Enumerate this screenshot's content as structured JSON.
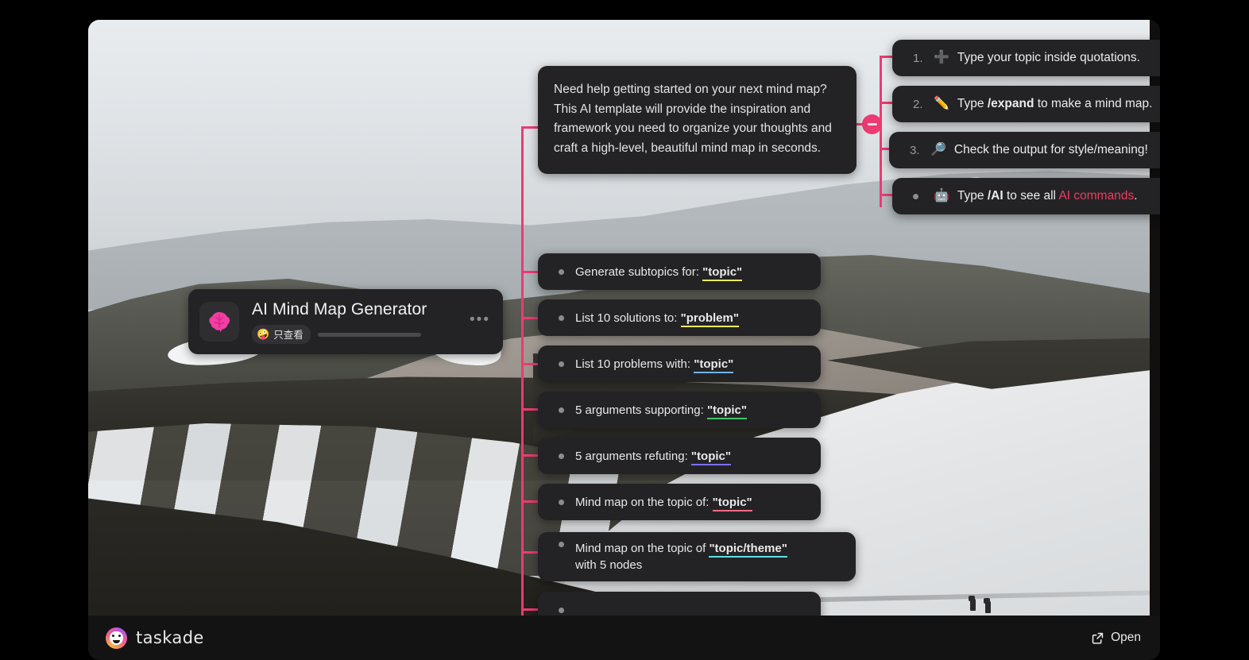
{
  "document": {
    "title": "AI Mind Map Generator",
    "permission_badge": "只查看",
    "permission_emoji": "🤪",
    "menu_label": "•••",
    "avatar_icon": "brain-icon"
  },
  "description": {
    "text": "Need help getting started on your next mind map? This AI template will provide the inspiration and framework you need to organize your thoughts and craft a high-level, beautiful mind map in seconds."
  },
  "steps": [
    {
      "marker": "1.",
      "marker_type": "number",
      "emoji": "➕",
      "icon": "plus-icon",
      "pre": "Type your topic inside quotations.",
      "bold": "",
      "post": "",
      "link": "",
      "tail": ""
    },
    {
      "marker": "2.",
      "marker_type": "number",
      "emoji": "✏️",
      "icon": "pencil-icon",
      "pre": "Type ",
      "bold": "/expand",
      "post": " to make a mind map.",
      "link": "",
      "tail": ""
    },
    {
      "marker": "3.",
      "marker_type": "number",
      "emoji": "🔎",
      "icon": "magnifier-icon",
      "pre": "Check the output for style/meaning!",
      "bold": "",
      "post": "",
      "link": "",
      "tail": ""
    },
    {
      "marker": "•",
      "marker_type": "bullet",
      "emoji": "🤖",
      "icon": "robot-icon",
      "pre": "Type ",
      "bold": "/AI",
      "post": " to see all ",
      "link": "AI commands",
      "tail": "."
    }
  ],
  "prompts": [
    {
      "pre": "Generate subtopics for: ",
      "token": "\"topic\"",
      "underline": "u-yellow",
      "second_line": ""
    },
    {
      "pre": "List 10 solutions to: ",
      "token": "\"problem\"",
      "underline": "u-yellow",
      "second_line": ""
    },
    {
      "pre": "List 10 problems with: ",
      "token": "\"topic\"",
      "underline": "u-blue",
      "second_line": ""
    },
    {
      "pre": "5 arguments supporting: ",
      "token": "\"topic\"",
      "underline": "u-green",
      "second_line": ""
    },
    {
      "pre": "5 arguments refuting: ",
      "token": "\"topic\"",
      "underline": "u-purple",
      "second_line": ""
    },
    {
      "pre": "Mind map on the topic of: ",
      "token": "\"topic\"",
      "underline": "u-pink",
      "second_line": ""
    },
    {
      "pre": "Mind map on the topic of ",
      "token": "\"topic/theme\"",
      "underline": "u-cyan",
      "second_line": "with 5 nodes"
    },
    {
      "pre": "",
      "token": "",
      "underline": "",
      "second_line": ""
    }
  ],
  "controls": {
    "collapse_label": "−",
    "collapse_icon": "minus-circle-icon"
  },
  "footer": {
    "brand": "taskade",
    "brand_icon": "taskade-logo-icon",
    "open_label": "Open",
    "open_icon": "external-link-icon"
  },
  "colors": {
    "accent_pink": "#ec3a72",
    "link_pink": "#ef3b63",
    "card_bg": "#232325",
    "page_bg": "#000000",
    "bar_bg": "#131314"
  }
}
